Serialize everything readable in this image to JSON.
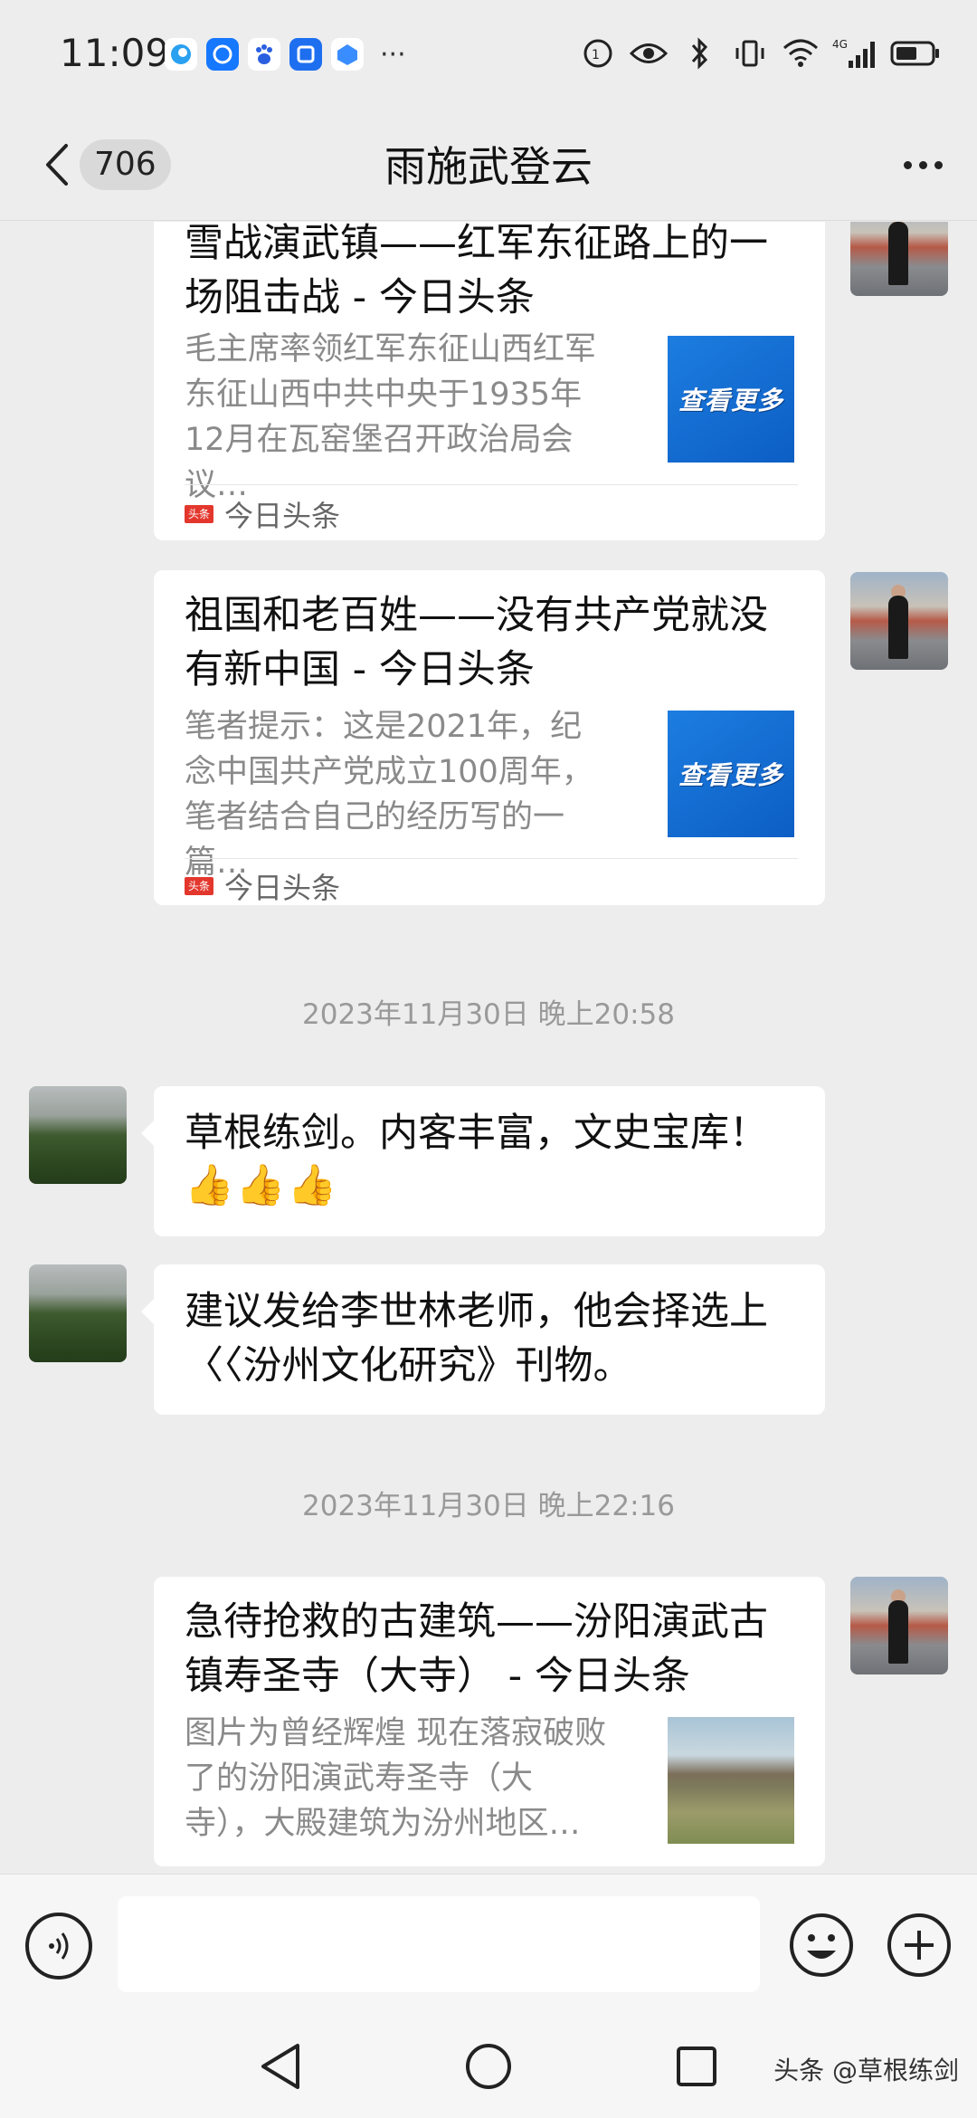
{
  "status_bar": {
    "time": "11:09",
    "more": "···",
    "network": "4G"
  },
  "header": {
    "unread_count": "706",
    "title": "雨施武登云"
  },
  "messages": [
    {
      "title": "雪战演武镇——红军东征路上的一场阻击战 - 今日头条",
      "desc": "毛主席率领红军东征山西红军东征山西中共中央于1935年12月在瓦窑堡召开政治局会议…",
      "source": "今日头条",
      "thumb_text": "查看更多"
    },
    {
      "title": "祖国和老百姓——没有共产党就没有新中国 - 今日头条",
      "desc": "笔者提示：这是2021年，纪念中国共产党成立100周年，笔者结合自己的经历写的一篇…",
      "source": "今日头条",
      "thumb_text": "查看更多"
    },
    {
      "timestamp": "2023年11月30日 晚上20:58"
    },
    {
      "text": "草根练剑。内客丰富，文史宝库！",
      "emoji": [
        "👍",
        "👍",
        "👍"
      ]
    },
    {
      "text": "建议发给李世林老师，他会择选上〈〈汾州文化研究》刊物。"
    },
    {
      "timestamp": "2023年11月30日 晚上22:16"
    },
    {
      "title": "急待抢救的古建筑——汾阳演武古镇寿圣寺（大寺） - 今日头条",
      "desc": "图片为曾经辉煌 现在落寂破败了的汾阳演武寿圣寺（大寺），大殿建筑为汾州地区…"
    }
  ],
  "source_logo": "头条",
  "watermark": "头条 @草根练剑",
  "colors": {
    "background": "#ededed",
    "bubble": "#ffffff",
    "toutiao_red": "#e3372d",
    "thumb_blue": "#1d7de0"
  }
}
